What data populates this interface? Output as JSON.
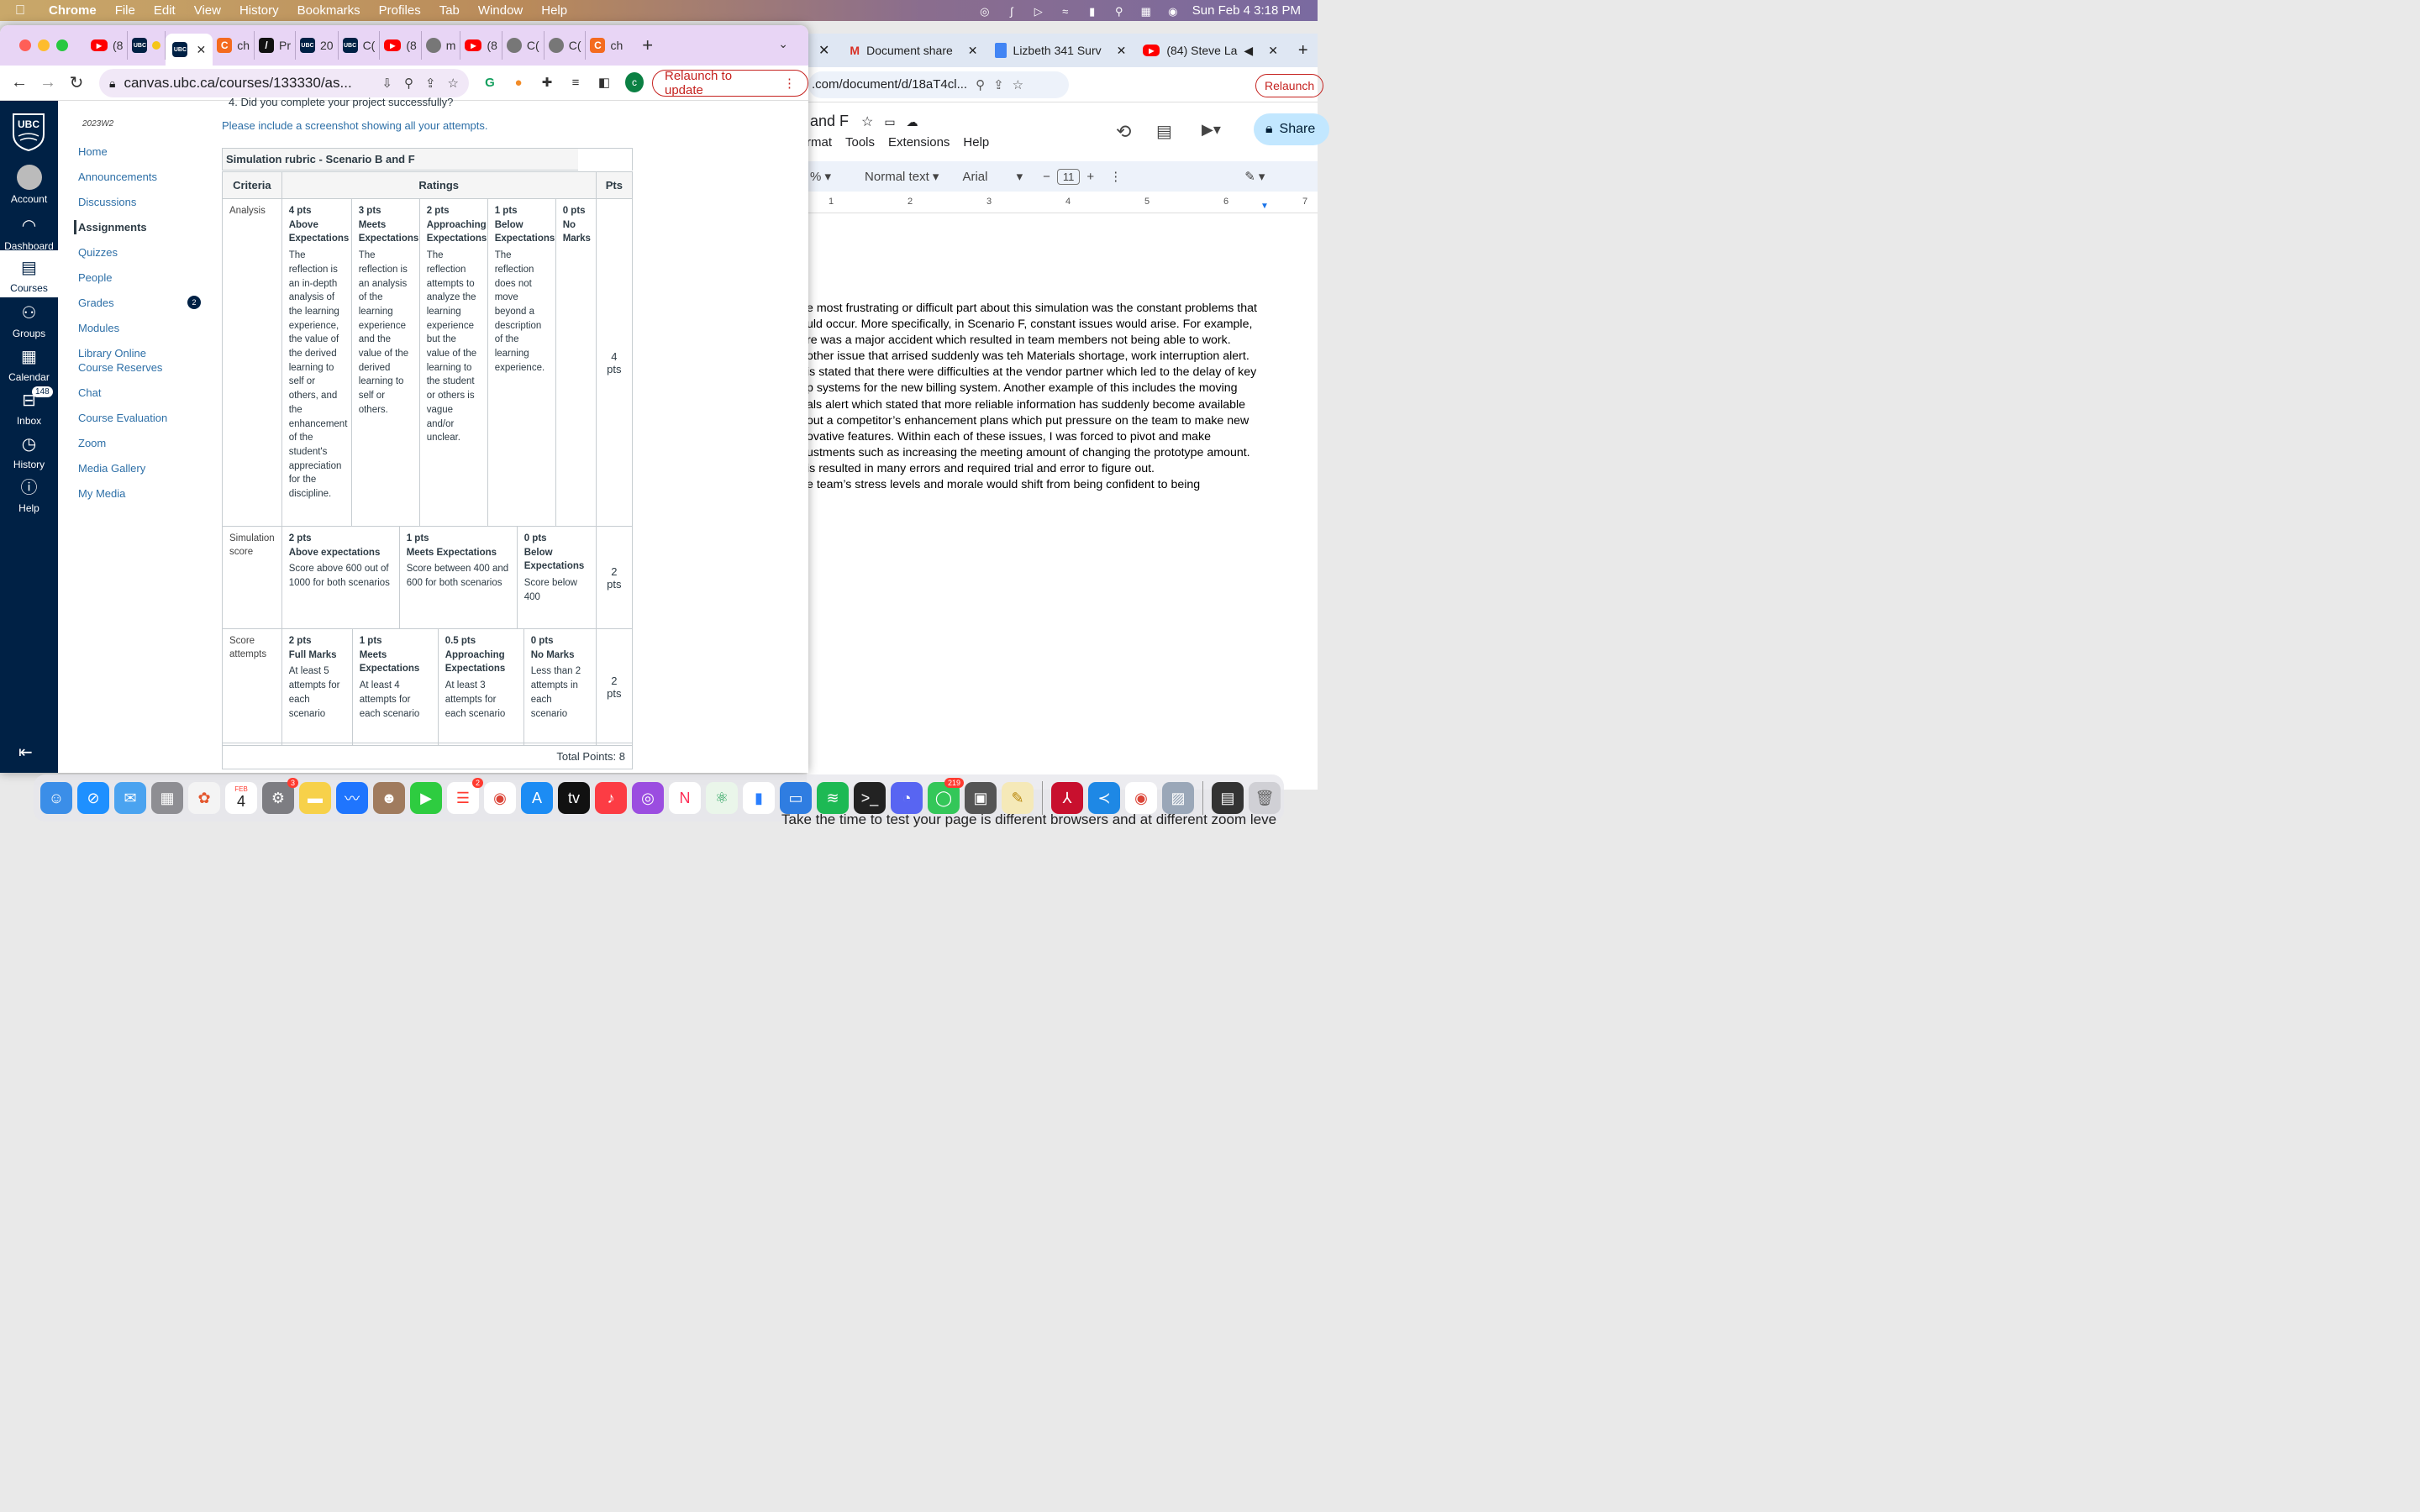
{
  "menubar": {
    "app": "Chrome",
    "items": [
      "File",
      "Edit",
      "View",
      "History",
      "Bookmarks",
      "Profiles",
      "Tab",
      "Window",
      "Help"
    ],
    "clock": "Sun Feb 4  3:18 PM"
  },
  "docwin": {
    "tabs": [
      "Document share",
      "Lizbeth 341 Surv",
      "(84) Steve La"
    ],
    "url": ".com/document/d/18aT4cl...",
    "relaunch": "Relaunch",
    "title": "and F",
    "menus": [
      "rmat",
      "Tools",
      "Extensions",
      "Help"
    ],
    "share": "Share",
    "zoom": "%",
    "style": "Normal text",
    "font": "Arial",
    "font_size": "11",
    "ruler": [
      "1",
      "2",
      "3",
      "4",
      "5",
      "6",
      "7"
    ],
    "body_lines": [
      "e most frustrating or difficult part about this simulation was the constant problems that",
      "uld occur. More specifically, in Scenario F, constant issues would arise. For example,",
      "re was a major accident which resulted in team members not being able to work.",
      "other issue that arrised suddenly was teh Materials shortage, work interruption alert.",
      "is stated that there were difficulties at the vendor partner  which led to the delay of key",
      "p systems for the new billing system. Another example of this includes the moving",
      "als alert which stated that more reliable information has suddenly become available",
      "out a competitor’s enhancement plans which put pressure on the team to make new",
      "ovative features. Within each of these issues, I was forced to pivot and make",
      "ustments such as increasing the meeting amount of changing the prototype amount.",
      "is resulted in many errors and required trial and error to figure out.",
      "e team’s stress levels and morale would shift from being confident to being"
    ],
    "bottom_text": "Take the time to test your page is different browsers and at different zoom leve"
  },
  "chrome": {
    "tabs": [
      {
        "icon": "yt",
        "label": "(8"
      },
      {
        "icon": "ubc",
        "label": ""
      },
      {
        "icon": "ubc",
        "label": ""
      },
      {
        "icon": "c",
        "label": "ch"
      },
      {
        "icon": "slash",
        "label": "Pr"
      },
      {
        "icon": "ubc",
        "label": "20"
      },
      {
        "icon": "ubc",
        "label": "C("
      },
      {
        "icon": "yt",
        "label": "(8"
      },
      {
        "icon": "globe",
        "label": "m"
      },
      {
        "icon": "yt",
        "label": "(8"
      },
      {
        "icon": "globe",
        "label": "C("
      },
      {
        "icon": "globe",
        "label": "C("
      },
      {
        "icon": "c",
        "label": "ch"
      }
    ],
    "url": "canvas.ubc.ca/courses/133330/as...",
    "relaunch": "Relaunch to update",
    "profile_letter": "c"
  },
  "globalnav": {
    "logo": "UBC",
    "items": [
      {
        "label": "Account",
        "icon": "account-icon"
      },
      {
        "label": "Dashboard",
        "icon": "dashboard-icon"
      },
      {
        "label": "Courses",
        "icon": "courses-icon"
      },
      {
        "label": "Groups",
        "icon": "groups-icon"
      },
      {
        "label": "Calendar",
        "icon": "calendar-icon"
      },
      {
        "label": "Inbox",
        "icon": "inbox-icon",
        "badge": "148"
      },
      {
        "label": "History",
        "icon": "history-icon"
      },
      {
        "label": "Help",
        "icon": "help-icon"
      }
    ]
  },
  "coursenav": {
    "term": "2023W2",
    "items": [
      "Home",
      "Announcements",
      "Discussions",
      "Assignments",
      "Quizzes",
      "People",
      "Grades",
      "Modules",
      "Library Online Course Reserves",
      "Chat",
      "Course Evaluation",
      "Zoom",
      "Media Gallery",
      "My Media"
    ],
    "grades_badge": "2"
  },
  "content": {
    "cutoff_text": "4.  Did you complete your project successfully?",
    "instruction": "Please include a screenshot showing all your attempts.",
    "rubric_title": "Simulation rubric - Scenario B and F",
    "headers": {
      "criteria": "Criteria",
      "ratings": "Ratings",
      "pts": "Pts"
    },
    "rows": [
      {
        "criterion": "Analysis",
        "points": "4 pts",
        "ratings": [
          {
            "pts": "4 pts",
            "title": "Above Expectations",
            "desc": "The reflection is an in-depth analysis of the learning experience, the value of the derived learning to self or others, and the enhancement of the student's appreciation for the discipline."
          },
          {
            "pts": "3 pts",
            "title": "Meets Expectations",
            "desc": "The reflection is an analysis of the learning experience and the value of the derived learning to self or others."
          },
          {
            "pts": "2 pts",
            "title": "Approaching Expectations",
            "desc": "The reflection attempts to analyze the learning experience but the value of the learning to the student or others is vague and/or unclear."
          },
          {
            "pts": "1 pts",
            "title": "Below Expectations",
            "desc": "The reflection does not move beyond a description of the learning experience."
          },
          {
            "pts": "0 pts",
            "title": "No Marks",
            "desc": ""
          }
        ]
      },
      {
        "criterion": "Simulation score",
        "points": "2 pts",
        "ratings": [
          {
            "pts": "2 pts",
            "title": "Above expectations",
            "desc": "Score above 600 out of 1000 for both scenarios"
          },
          {
            "pts": "1 pts",
            "title": "Meets Expectations",
            "desc": "Score between 400 and 600 for both scenarios"
          },
          {
            "pts": "0 pts",
            "title": "Below Expectations",
            "desc": "Score below 400"
          }
        ]
      },
      {
        "criterion": "Score attempts",
        "points": "2 pts",
        "ratings": [
          {
            "pts": "2 pts",
            "title": "Full Marks",
            "desc": "At least 5 attempts for each scenario"
          },
          {
            "pts": "1 pts",
            "title": "Meets Expectations",
            "desc": "At least 4 attempts for each scenario"
          },
          {
            "pts": "0.5 pts",
            "title": "Approaching Expectations",
            "desc": "At least 3 attempts for each scenario"
          },
          {
            "pts": "0 pts",
            "title": "No Marks",
            "desc": "Less than 2 attempts in each scenario"
          }
        ]
      }
    ],
    "total": "Total Points: 8"
  },
  "dock": {
    "calendar_month": "FEB",
    "calendar_day": "4",
    "badges": {
      "settings": "3",
      "reminders": "2",
      "messages": "219"
    }
  }
}
